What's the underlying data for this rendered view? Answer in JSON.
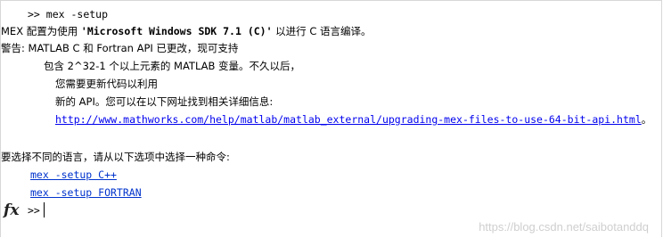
{
  "console": {
    "lines": [
      {
        "prompt": ">>",
        "text": "mex -setup"
      },
      {
        "prefix": "MEX 配置为使用 ",
        "bold": "'Microsoft Windows SDK 7.1 (C)'",
        "suffix": " 以进行 C 语言编译。"
      },
      {
        "text": "警告: MATLAB C 和 Fortran API 已更改，现可支持"
      },
      {
        "text": "包含 2^32-1 个以上元素的 MATLAB 变量。不久以后，"
      },
      {
        "text": "您需要更新代码以利用"
      },
      {
        "text": "新的 API。您可以在以下网址找到相关详细信息:"
      },
      {
        "link": "http://www.mathworks.com/help/matlab/matlab_external/upgrading-mex-files-to-use-64-bit-api.html",
        "suffix": "。"
      },
      {
        "text": "要选择不同的语言，请从以下选项中选择一种命令:"
      },
      {
        "link": "mex -setup C++"
      },
      {
        "link": "mex -setup FORTRAN"
      },
      {
        "prompt": ">>",
        "text": ""
      }
    ],
    "fx_label": "fx",
    "watermark": "https://blog.csdn.net/saibotanddq"
  }
}
